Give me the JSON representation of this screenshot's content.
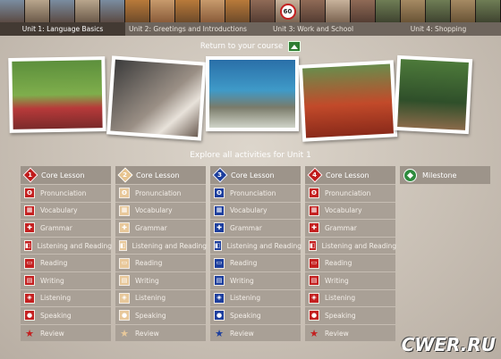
{
  "tabs": [
    {
      "label": "Unit 1: Language Basics",
      "active": true
    },
    {
      "label": "Unit 2: Greetings and Introductions",
      "active": false
    },
    {
      "label": "Unit 3: Work and School",
      "active": false
    },
    {
      "label": "Unit 4: Shopping",
      "active": false
    }
  ],
  "strip_sign": "60",
  "return_label": "Return to your course",
  "explore_label": "Explore all activities for Unit 1",
  "columns": [
    {
      "number": "1",
      "title": "Core Lesson",
      "color": "#c01c1c"
    },
    {
      "number": "2",
      "title": "Core Lesson",
      "color": "#e7c48f"
    },
    {
      "number": "3",
      "title": "Core Lesson",
      "color": "#1b3d9c"
    },
    {
      "number": "4",
      "title": "Core Lesson",
      "color": "#c01c1c"
    },
    {
      "title": "Milestone",
      "color": "#2e8b3e"
    }
  ],
  "activities": [
    {
      "label": "Pronunciation",
      "icon": "pronunciation-icon"
    },
    {
      "label": "Vocabulary",
      "icon": "vocabulary-icon"
    },
    {
      "label": "Grammar",
      "icon": "grammar-icon"
    },
    {
      "label": "Listening and Reading",
      "icon": "listening-reading-icon"
    },
    {
      "label": "Reading",
      "icon": "reading-icon"
    },
    {
      "label": "Writing",
      "icon": "writing-icon"
    },
    {
      "label": "Listening",
      "icon": "listening-icon"
    },
    {
      "label": "Speaking",
      "icon": "speaking-icon"
    },
    {
      "label": "Review",
      "icon": "review-star-icon"
    }
  ],
  "watermark": "CWER.RU"
}
